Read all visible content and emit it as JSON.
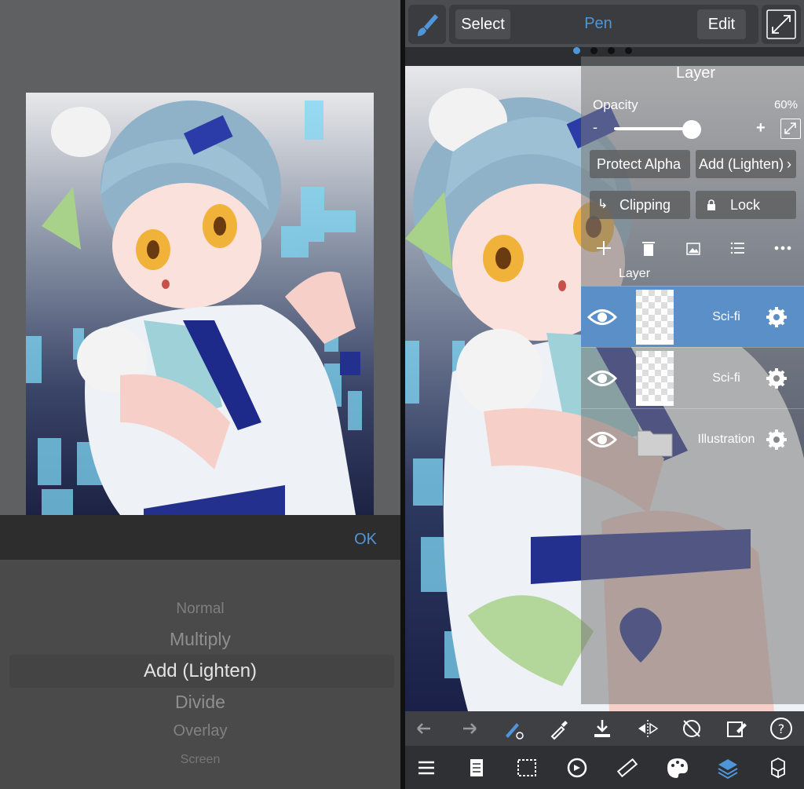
{
  "left": {
    "ok_label": "OK",
    "blend_modes": [
      "Normal",
      "Multiply",
      "Add (Lighten)",
      "Divide",
      "Overlay",
      "Screen"
    ],
    "selected_mode": "Add (Lighten)"
  },
  "topbar": {
    "select_label": "Select",
    "pen_label": "Pen",
    "edit_label": "Edit",
    "page_dots": 4,
    "active_dot": 1
  },
  "layer_panel": {
    "title": "Layer",
    "opacity_label": "Opacity",
    "opacity_value": "60%",
    "opacity_fraction": 0.6,
    "minus": "-",
    "plus": "+",
    "protect_alpha_label": "Protect Alpha",
    "blend_label": "Add (Lighten)",
    "clipping_label": "Clipping",
    "lock_label": "Lock",
    "section_label": "Layer",
    "layers": [
      {
        "name": "Sci-fi",
        "selected": true,
        "type": "layer"
      },
      {
        "name": "Sci-fi",
        "selected": false,
        "type": "layer"
      },
      {
        "name": "Illustration",
        "selected": false,
        "type": "folder"
      }
    ]
  },
  "toolbar_icons": [
    "undo-icon",
    "redo-icon",
    "pen-swap-icon",
    "eyedropper-icon",
    "save-icon",
    "flip-icon",
    "rotate-reset-icon",
    "eraser-icon",
    "help-icon"
  ],
  "nav_icons": [
    "menu-icon",
    "pages-icon",
    "selection-icon",
    "transform-icon",
    "ruler-icon",
    "palette-icon",
    "layers-icon",
    "materials-icon"
  ],
  "colors": {
    "accent": "#4f96d8",
    "selected_layer": "#5b8fc8"
  }
}
